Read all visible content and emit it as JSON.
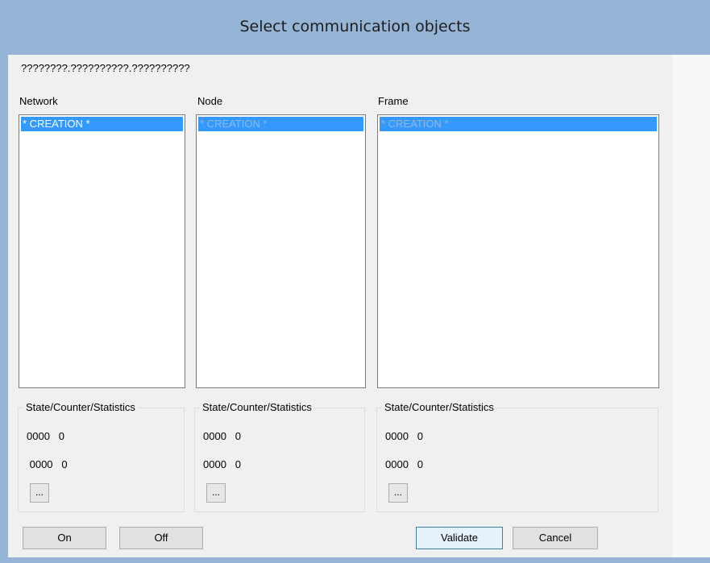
{
  "window": {
    "title": "Select communication objects"
  },
  "path_text": "????????.??????????.??????????",
  "columns": [
    {
      "label": "Network",
      "selected_item": "* CREATION *",
      "stats_label": "State/Counter/Statistics",
      "stat_line_1": "0000   0",
      "stat_line_2": " 0000   0",
      "more_label": "..."
    },
    {
      "label": "Node",
      "selected_item": "* CREATION *",
      "stats_label": "State/Counter/Statistics",
      "stat_line_1": "0000   0",
      "stat_line_2": "0000   0",
      "more_label": "..."
    },
    {
      "label": "Frame",
      "selected_item": "* CREATION *",
      "stats_label": "State/Counter/Statistics",
      "stat_line_1": "0000   0",
      "stat_line_2": "0000   0",
      "more_label": "..."
    }
  ],
  "buttons": {
    "on": "On",
    "off": "Off",
    "validate": "Validate",
    "cancel": "Cancel"
  }
}
